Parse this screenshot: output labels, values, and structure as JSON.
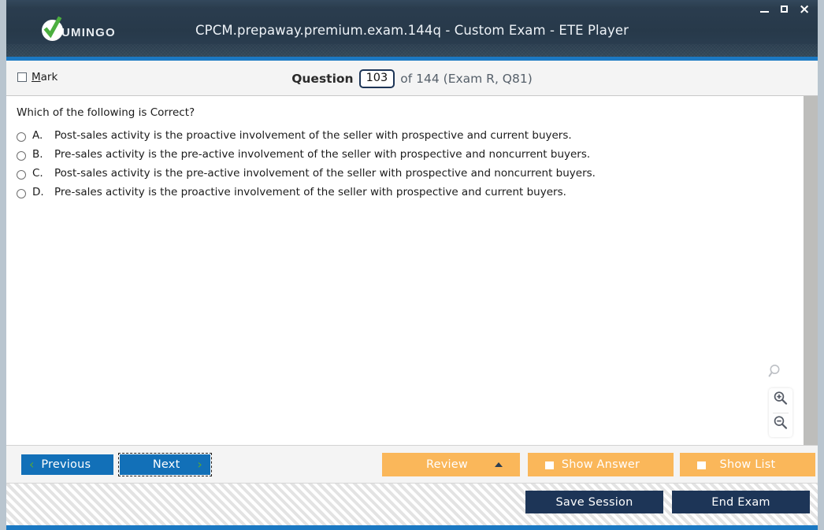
{
  "window": {
    "title": "CPCM.prepaway.premium.exam.144q - Custom Exam - ETE Player",
    "logo_text": "UMINGO",
    "controls": {
      "minimize": "minimize-icon",
      "maximize": "maximize-icon",
      "close": "×"
    }
  },
  "header": {
    "mark_label_first": "M",
    "mark_label_rest": "ark",
    "question_word": "Question",
    "question_number": "103",
    "rest": "of 144 (Exam R, Q81)"
  },
  "question": {
    "prompt": "Which of the following is Correct?",
    "options": [
      {
        "letter": "A.",
        "text": "Post-sales activity is the proactive involvement of the seller with prospective and current buyers."
      },
      {
        "letter": "B.",
        "text": "Pre-sales activity is the pre-active involvement of the seller with prospective and noncurrent buyers."
      },
      {
        "letter": "C.",
        "text": "Post-sales activity is the pre-active involvement of the seller with prospective and noncurrent buyers."
      },
      {
        "letter": "D.",
        "text": "Pre-sales activity is the proactive involvement of the seller with prospective and current buyers."
      }
    ]
  },
  "zoom_controls": {
    "search_icon": "magnifier-icon",
    "zoom_in_icon": "zoom-in-icon",
    "zoom_out_icon": "zoom-out-icon"
  },
  "toolbar": {
    "previous_label": "Previous",
    "previous_chevron": "‹",
    "next_label": "Next",
    "next_chevron": "›",
    "review_label": "Review",
    "show_answer_label": "Show Answer",
    "show_list_label": "Show List"
  },
  "footer": {
    "save_session_label": "Save Session",
    "end_exam_label": "End Exam"
  },
  "colors": {
    "titlebar": "#2c3e50",
    "accent_blue": "#1b79c3",
    "nav_blue": "#1270b8",
    "orange": "#fab75a",
    "dark_navy": "#1d3557",
    "chevron_green": "#5aa832"
  }
}
